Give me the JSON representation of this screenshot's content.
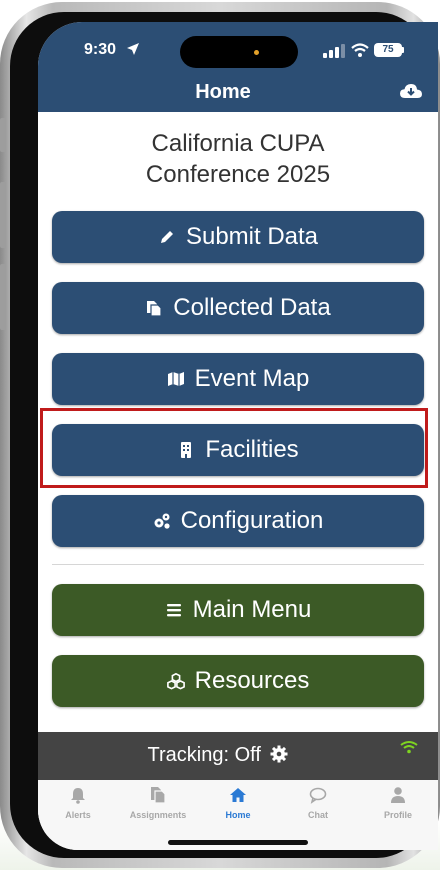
{
  "status_bar": {
    "time": "9:30",
    "battery": "75"
  },
  "header": {
    "title": "Home"
  },
  "conference_title": "California CUPA\nConference 2025",
  "buttons": [
    {
      "label": "Submit Data",
      "icon": "pencil-icon",
      "color": "#2c4e74"
    },
    {
      "label": "Collected Data",
      "icon": "copy-icon",
      "color": "#2c4e74"
    },
    {
      "label": "Event Map",
      "icon": "map-icon",
      "color": "#2c4e74"
    },
    {
      "label": "Facilities",
      "icon": "building-icon",
      "color": "#2c4e74"
    },
    {
      "label": "Configuration",
      "icon": "cogs-icon",
      "color": "#2c4e74"
    },
    {
      "label": "Main Menu",
      "icon": "bars-icon",
      "color": "#3c5a26"
    },
    {
      "label": "Resources",
      "icon": "cubes-icon",
      "color": "#3c5a26"
    }
  ],
  "tracking": {
    "label": "Tracking:",
    "state": "Off"
  },
  "tabs": [
    {
      "label": "Alerts",
      "icon": "bell-icon"
    },
    {
      "label": "Assignments",
      "icon": "clipboard-icon"
    },
    {
      "label": "Home",
      "icon": "home-icon",
      "active": true
    },
    {
      "label": "Chat",
      "icon": "chat-icon"
    },
    {
      "label": "Profile",
      "icon": "user-icon"
    }
  ],
  "colors": {
    "header_blue": "#2c4e74",
    "green": "#3c5a26",
    "highlight_red": "#c01b1b",
    "tab_active": "#2b7ad4",
    "wifi_green": "#7ed321"
  }
}
